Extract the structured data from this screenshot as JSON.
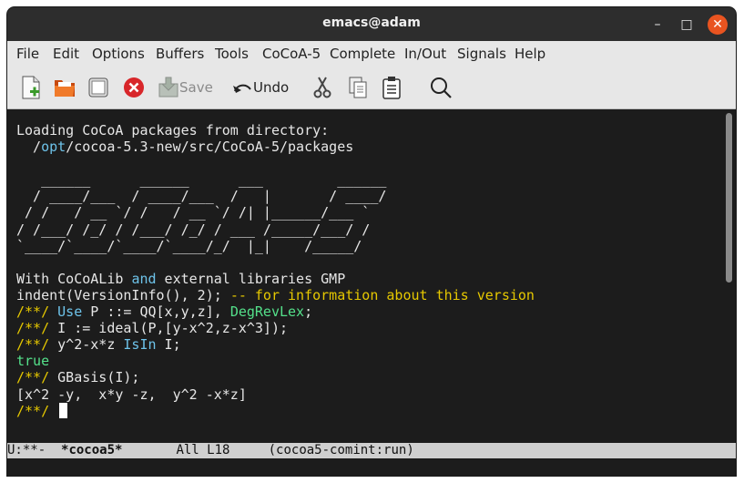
{
  "window": {
    "title": "emacs@adam",
    "controls": {
      "minimize": "–",
      "maximize": "□",
      "close": "✕"
    }
  },
  "menubar": {
    "items": [
      "File",
      "Edit",
      "Options",
      "Buffers",
      "Tools",
      "CoCoA-5",
      "Complete",
      "In/Out",
      "Signals",
      "Help"
    ]
  },
  "toolbar": {
    "save_label": "Save",
    "undo_label": "Undo",
    "icons": [
      "new-file-icon",
      "open-folder-icon",
      "dired-icon",
      "close-buffer-icon",
      "save-icon",
      "undo-icon",
      "cut-icon",
      "copy-icon",
      "paste-icon",
      "search-icon"
    ]
  },
  "buffer": {
    "lines": [
      [
        {
          "t": "Loading CoCoA packages from directory:",
          "c": "default"
        }
      ],
      [
        {
          "t": "  /",
          "c": "default"
        },
        {
          "t": "opt",
          "c": "path"
        },
        {
          "t": "/cocoa-5.3-new/src/CoCoA-5/packages",
          "c": "default"
        }
      ],
      [
        {
          "t": "",
          "c": "default"
        }
      ],
      [
        {
          "t": "   ______      ______      ___         ______",
          "c": "default"
        }
      ],
      [
        {
          "t": "  / ____/___  / ____/___  /   |       / ____/",
          "c": "default"
        }
      ],
      [
        {
          "t": " / /   / __ `/ /   / __ `/ /| |______/___ `",
          "c": "default"
        }
      ],
      [
        {
          "t": "/ /___/ /_/ / /___/ /_/ / ___ /_____/___/ /",
          "c": "default"
        }
      ],
      [
        {
          "t": "`____/`____/`____/`____/_/  |_|    /_____/",
          "c": "default"
        }
      ],
      [
        {
          "t": "",
          "c": "default"
        }
      ],
      [
        {
          "t": "With CoCoALib ",
          "c": "default"
        },
        {
          "t": "and",
          "c": "keyword"
        },
        {
          "t": " external libraries GMP",
          "c": "default"
        }
      ],
      [
        {
          "t": "indent(VersionInfo(), 2); ",
          "c": "default"
        },
        {
          "t": "-- for information about this version",
          "c": "comment"
        }
      ],
      [
        {
          "t": "/**/ ",
          "c": "prompt"
        },
        {
          "t": "Use",
          "c": "keyword"
        },
        {
          "t": " P ::= QQ[x,y,z], ",
          "c": "default"
        },
        {
          "t": "DegRevLex",
          "c": "builtin"
        },
        {
          "t": ";",
          "c": "default"
        }
      ],
      [
        {
          "t": "/**/ ",
          "c": "prompt"
        },
        {
          "t": "I := ideal(P,[y-x^2,z-x^3]);",
          "c": "default"
        }
      ],
      [
        {
          "t": "/**/ ",
          "c": "prompt"
        },
        {
          "t": "y^2-x*z ",
          "c": "default"
        },
        {
          "t": "IsIn",
          "c": "keyword"
        },
        {
          "t": " I;",
          "c": "default"
        }
      ],
      [
        {
          "t": "true",
          "c": "constant"
        }
      ],
      [
        {
          "t": "/**/ ",
          "c": "prompt"
        },
        {
          "t": "GBasis(I);",
          "c": "default"
        }
      ],
      [
        {
          "t": "[x^2 -y,  x*y -z,  y^2 -x*z]",
          "c": "default"
        }
      ],
      [
        {
          "t": "/**/ ",
          "c": "prompt"
        }
      ]
    ]
  },
  "modeline": {
    "status": "U:**-  ",
    "buffer_name": "*cocoa5*",
    "position": "       All L18     ",
    "mode": "(cocoa5-comint:run)"
  },
  "colors": {
    "prompt": "#e6c800",
    "keyword": "#6ec3ea",
    "builtin": "#54e08a",
    "close_button": "#e95420"
  }
}
